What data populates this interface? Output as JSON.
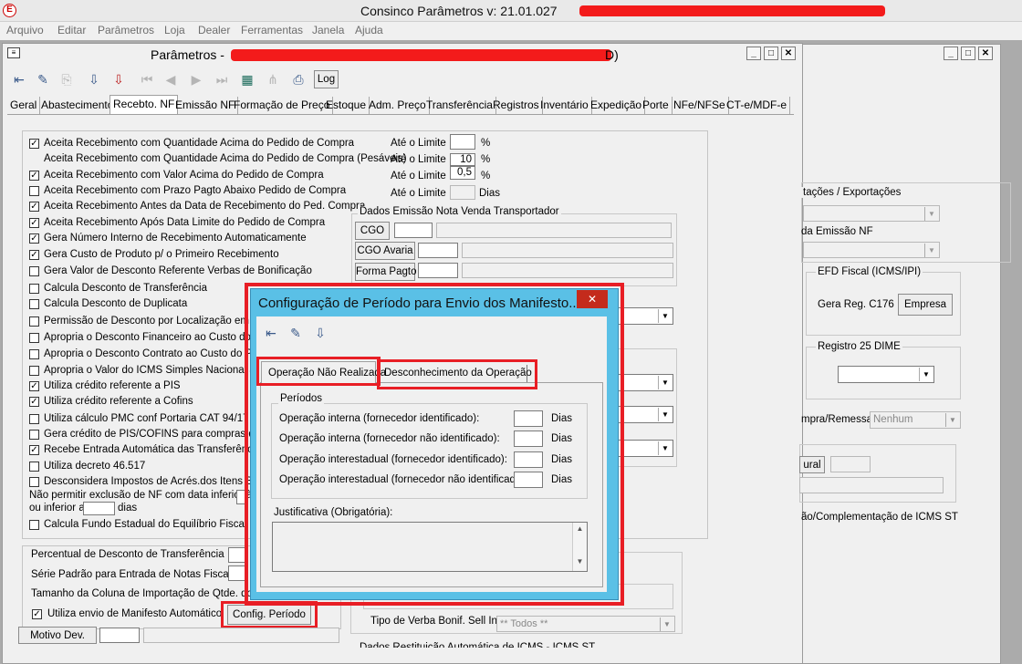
{
  "app": {
    "icon_letter": "E",
    "title": "Consinco Parâmetros  v: 21.01.027"
  },
  "menu": [
    "Arquivo",
    "Editar",
    "Parâmetros",
    "Loja",
    "Dealer",
    "Ferramentas",
    "Janela",
    "Ajuda"
  ],
  "child_window": {
    "title": "Parâmetros -",
    "title_suffix": "D)"
  },
  "toolbar": {
    "log_label": "Log"
  },
  "tabs": [
    "Geral",
    "Abastecimento",
    "Recebto. NF",
    "Emissão NF",
    "Formação de Preço",
    "Estoque",
    "Adm. Preço",
    "Transferência",
    "Registros",
    "Inventário",
    "Expedição",
    "Porte",
    "NFe/NFSe",
    "CT-e/MDF-e"
  ],
  "options": [
    {
      "label": "Aceita Recebimento com Quantidade Acima do Pedido de Compra",
      "checked": true
    },
    {
      "label": "Aceita Recebimento com Quantidade Acima do Pedido de Compra (Pesáveis)",
      "checked": null
    },
    {
      "label": "Aceita Recebimento com Valor Acima do Pedido de Compra",
      "checked": true
    },
    {
      "label": "Aceita Recebimento com Prazo Pagto Abaixo Pedido de Compra",
      "checked": false
    },
    {
      "label": "Aceita Recebimento Antes da Data de Recebimento do Ped. Compra",
      "checked": true
    },
    {
      "label": "Aceita Recebimento Após Data Limite do Pedido de Compra",
      "checked": true
    },
    {
      "label": "Gera Número Interno de Recebimento Automaticamente",
      "checked": true
    },
    {
      "label": "Gera Custo de Produto p/ o Primeiro Recebimento",
      "checked": true
    },
    {
      "label": "Gera Valor de Desconto Referente Verbas de Bonificação",
      "checked": false
    },
    {
      "label": "Calcula Desconto de Transferência",
      "checked": false
    },
    {
      "label": "Calcula Desconto de Duplicata",
      "checked": false
    },
    {
      "label": "Permissão de Desconto por Localização em Ár",
      "checked": false
    },
    {
      "label": "Apropria o Desconto Financeiro ao Custo do P",
      "checked": false
    },
    {
      "label": "Apropria o Desconto Contrato ao Custo do Pro",
      "checked": false
    },
    {
      "label": "Apropria o Valor do ICMS Simples Nacional ao",
      "checked": false
    },
    {
      "label": "Utiliza crédito referente a PIS",
      "checked": true
    },
    {
      "label": "Utiliza crédito referente a Cofins",
      "checked": true
    },
    {
      "label": "Utiliza cálculo PMC conf Portaria CAT 94/17 S",
      "checked": false
    },
    {
      "label": "Gera crédito de PIS/COFINS para compras de",
      "checked": false
    },
    {
      "label": "Recebe Entrada Automática das Transferência",
      "checked": true
    },
    {
      "label": "Utiliza decreto 46.517",
      "checked": false
    },
    {
      "label": "Desconsidera Impostos de Acrés.dos Itens Boni",
      "checked": false
    }
  ],
  "exclusion": {
    "line1": "Não permitir exclusão de NF com data inferior à",
    "line2": "ou inferior a",
    "days": "dias"
  },
  "fundo_label": "Calcula Fundo Estadual do Equilíbrio Fiscal e",
  "limits": [
    {
      "label": "Até o Limite",
      "value": "",
      "unit": "%"
    },
    {
      "label": "Até o Limite",
      "value": "10",
      "unit": "%"
    },
    {
      "label": "Até o Limite",
      "value": "0,5",
      "unit": "%"
    },
    {
      "label": "Até o Limite",
      "value": "",
      "unit": "Dias"
    }
  ],
  "transportador": {
    "title": "Dados Emissão Nota Venda Transportador",
    "cgo": "CGO",
    "cgo_avaria": "CGO Avaria",
    "forma_pagto": "Forma Pagto"
  },
  "bottom": {
    "percentual": "Percentual de Desconto de Transferência",
    "serie": "Série Padrão para Entrada de Notas Fiscais",
    "tamanho": "Tamanho da Coluna de Importação de Qtde. do C",
    "manifesto": "Utiliza envio de Manifesto Automático",
    "config_periodo": "Config. Período",
    "motivo": "Motivo Dev.",
    "verba_label": "Tipo de Verba Bonif. Sell In",
    "verba_value": "** Todos **",
    "bottom_cut": "Dados Restituição Automática de ICMS - ICMS ST"
  },
  "right_panel": {
    "exportacoes": "tações / Exportações",
    "emissao": "da Emissão NF",
    "efd_title": "EFD Fiscal (ICMS/IPI)",
    "gera_reg": "Gera Reg. C176",
    "empresa": "Empresa",
    "registro25": "Registro 25 DIME",
    "remessa_label": "mpra/Remessa",
    "remessa_value": "Nenhum",
    "rural": "ural",
    "complementacao": "ão/Complementação de ICMS ST"
  },
  "dialog": {
    "title": "Configuração de Período para Envio dos Manifesto...",
    "close": "✕",
    "tabs": [
      "Operação Não Realizada",
      "Desconhecimento da Operação"
    ],
    "periodos_title": "Períodos",
    "rows": [
      {
        "label": "Operação interna (fornecedor identificado):",
        "value": "",
        "unit": "Dias"
      },
      {
        "label": "Operação interna (fornecedor não identificado):",
        "value": "",
        "unit": "Dias"
      },
      {
        "label": "Operação interestadual (fornecedor identificado):",
        "value": "",
        "unit": "Dias"
      },
      {
        "label": "Operação interestadual (fornecedor não identificado):",
        "value": "",
        "unit": "Dias"
      }
    ],
    "justificativa": "Justificativa (Obrigatória):",
    "justificativa_value": ""
  },
  "colors": {
    "highlight": "#e81e25",
    "dialog_frame": "#5ac0e6",
    "redaction": "#f31b1b"
  }
}
